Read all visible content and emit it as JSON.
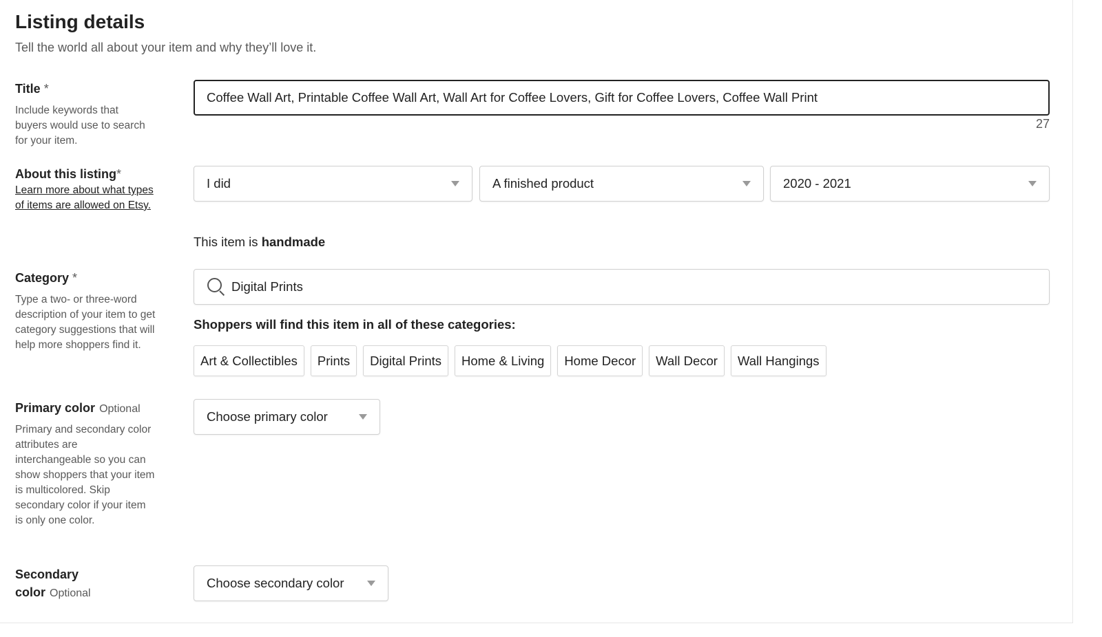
{
  "section": {
    "title": "Listing details",
    "subtitle": "Tell the world all about your item and why they’ll love it."
  },
  "title_field": {
    "label": "Title",
    "required_mark": "*",
    "help": "Include keywords that buyers would use to search for your item.",
    "value": "Coffee Wall Art, Printable Coffee Wall Art, Wall Art for Coffee Lovers, Gift for Coffee Lovers, Coffee Wall Print",
    "counter": "27"
  },
  "about": {
    "label": "About this listing",
    "required_mark": "*",
    "link": "Learn more about what types of items are allowed on Etsy.",
    "who_made": "I did",
    "what_is_it": "A finished product",
    "when_made": "2020 - 2021",
    "handmade_prefix": "This item is",
    "handmade_word": "handmade"
  },
  "category": {
    "label": "Category",
    "required_mark": "*",
    "help": "Type a two- or three-word description of your item to get category suggestions that will help more shoppers find it.",
    "value": "Digital Prints",
    "heading": "Shoppers will find this item in all of these categories:",
    "chips": [
      "Art & Collectibles",
      "Prints",
      "Digital Prints",
      "Home & Living",
      "Home Decor",
      "Wall Decor",
      "Wall Hangings"
    ]
  },
  "primary_color": {
    "label": "Primary color",
    "optional": "Optional",
    "help": "Primary and secondary color attributes are interchangeable so you can show shoppers that your item is multicolored. Skip secondary color if your item is only one color.",
    "placeholder": "Choose primary color"
  },
  "secondary_color": {
    "label_line1": "Secondary",
    "label_line2": "color",
    "optional": "Optional",
    "placeholder": "Choose secondary color"
  }
}
